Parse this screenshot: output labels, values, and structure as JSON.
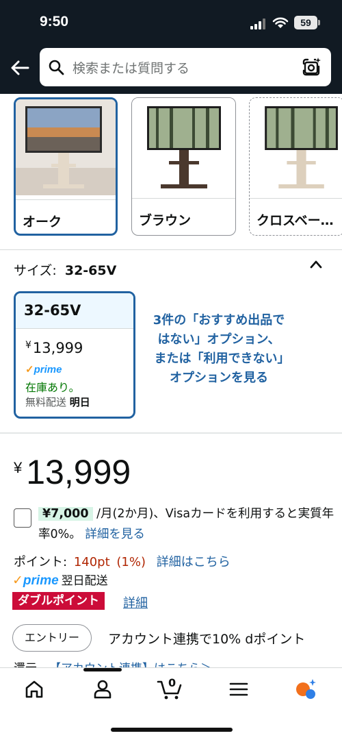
{
  "status_bar": {
    "time": "9:50",
    "battery": "59"
  },
  "header": {
    "search_placeholder": "検索または質問する"
  },
  "color_options": [
    {
      "label": "オーク",
      "selected": true
    },
    {
      "label": "ブラウン",
      "selected": false
    },
    {
      "label": "クロスベー…",
      "selected": false,
      "unavailable": true
    }
  ],
  "size_section": {
    "label": "サイズ:",
    "selected_value": "32-65V",
    "card": {
      "title": "32-65V",
      "currency": "¥",
      "price": "13,999",
      "prime_label": "prime",
      "stock": "在庫あり。",
      "shipping": "無料配送",
      "shipping_day": "明日"
    },
    "more_options_link": "3件の「おすすめ出品ではない」オプション、または「利用できない」オプションを見る"
  },
  "price": {
    "currency": "¥",
    "value": "13,999"
  },
  "installment": {
    "amount": "¥7,000",
    "text": "/月(2か月)、Visaカードを利用すると実質年率0%。",
    "link": "詳細を見る"
  },
  "points": {
    "label": "ポイント:",
    "value": "140pt",
    "percent": "(1%)",
    "link": "詳細はこちら"
  },
  "prime_delivery": {
    "prime_label": "prime",
    "text": "翌日配送"
  },
  "double_points": {
    "badge": "ダブルポイント",
    "link": "詳細"
  },
  "entry": {
    "button": "エントリー",
    "text": "アカウント連携で10% dポイント"
  },
  "account_link": {
    "prefix": "還元",
    "link": "【アカウント連携】はこちら＞"
  },
  "tab_bar": {
    "cart_count": "0"
  },
  "colors": {
    "header_bg": "#111a23",
    "accent_blue": "#2162a1",
    "price_red": "#b12704",
    "badge_red": "#cc0c39",
    "prime_blue": "#1a98ff"
  }
}
